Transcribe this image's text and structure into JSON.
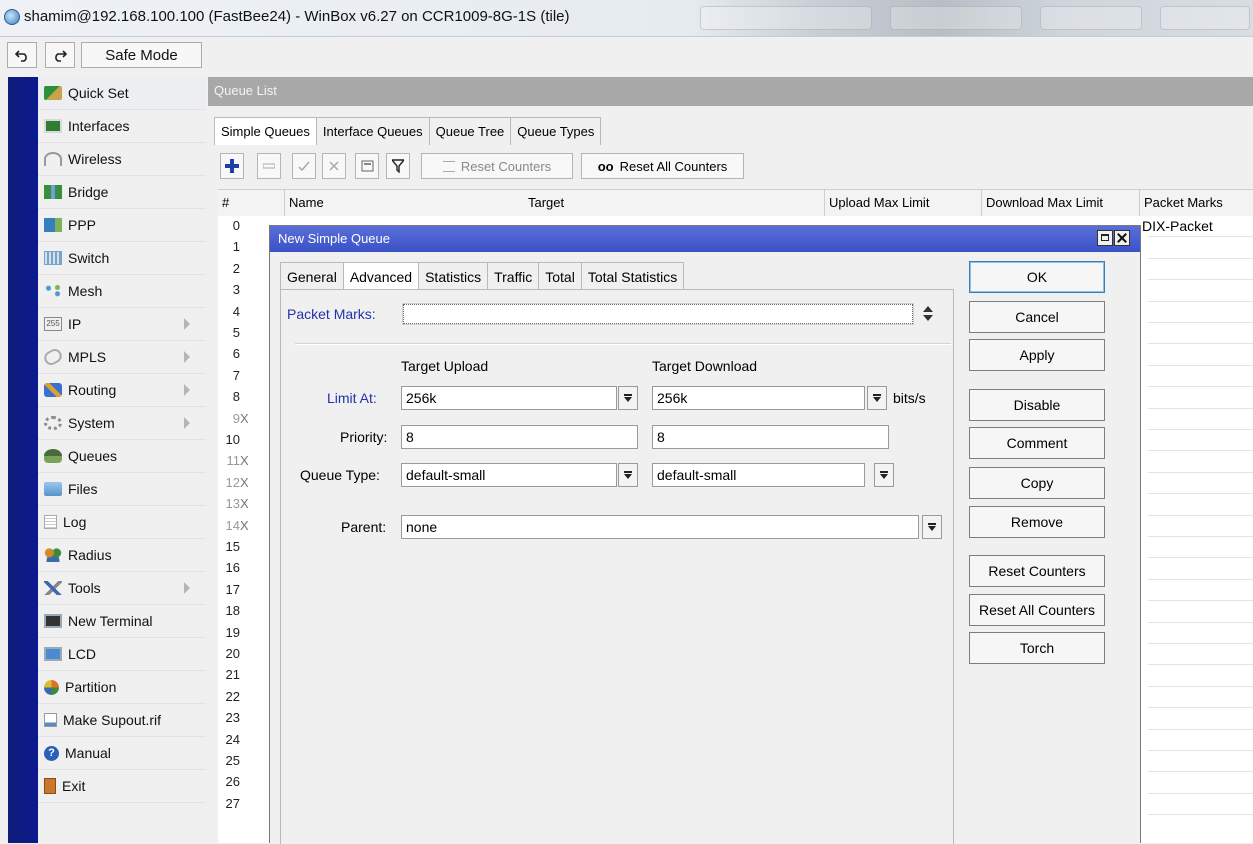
{
  "window": {
    "title": "shamim@192.168.100.100 (FastBee24) - WinBox v6.27 on CCR1009-8G-1S (tile)"
  },
  "toolbar": {
    "undo_icon": "undo-icon",
    "redo_icon": "redo-icon",
    "safe_mode_label": "Safe Mode"
  },
  "menu": {
    "items": [
      {
        "label": "Quick Set",
        "icon": "quick-set-icon",
        "color": "#3a8f3a",
        "submenu": false
      },
      {
        "label": "Interfaces",
        "icon": "interfaces-icon",
        "color": "#2e7d32",
        "submenu": false
      },
      {
        "label": "Wireless",
        "icon": "wireless-icon",
        "color": "#999999",
        "submenu": false
      },
      {
        "label": "Bridge",
        "icon": "bridge-icon",
        "color": "#3c8d3c",
        "submenu": false
      },
      {
        "label": "PPP",
        "icon": "ppp-icon",
        "color": "#3a7cc0",
        "submenu": false
      },
      {
        "label": "Switch",
        "icon": "switch-icon",
        "color": "#7aa3c7",
        "submenu": false
      },
      {
        "label": "Mesh",
        "icon": "mesh-icon",
        "color": "#4a9ad0",
        "submenu": false
      },
      {
        "label": "IP",
        "icon": "ip-icon",
        "color": "#8a8a8a",
        "submenu": true
      },
      {
        "label": "MPLS",
        "icon": "mpls-icon",
        "color": "#9a9a9a",
        "submenu": true
      },
      {
        "label": "Routing",
        "icon": "routing-icon",
        "color": "#3b6fd0",
        "submenu": true
      },
      {
        "label": "System",
        "icon": "system-icon",
        "color": "#8c8c8c",
        "submenu": true
      },
      {
        "label": "Queues",
        "icon": "queues-icon",
        "color": "#5a8a3a",
        "submenu": false
      },
      {
        "label": "Files",
        "icon": "files-icon",
        "color": "#6aa2d8",
        "submenu": false
      },
      {
        "label": "Log",
        "icon": "log-icon",
        "color": "#c0c0c0",
        "submenu": false
      },
      {
        "label": "Radius",
        "icon": "radius-icon",
        "color": "#d08a2a",
        "submenu": false
      },
      {
        "label": "Tools",
        "icon": "tools-icon",
        "color": "#3a6ab0",
        "submenu": true
      },
      {
        "label": "New Terminal",
        "icon": "terminal-icon",
        "color": "#333333",
        "submenu": false
      },
      {
        "label": "LCD",
        "icon": "lcd-icon",
        "color": "#4a8ad0",
        "submenu": false
      },
      {
        "label": "Partition",
        "icon": "partition-icon",
        "color": "#e0702a",
        "submenu": false
      },
      {
        "label": "Make Supout.rif",
        "icon": "supout-icon",
        "color": "#5a8ac0",
        "submenu": false
      },
      {
        "label": "Manual",
        "icon": "manual-icon",
        "color": "#2a60b8",
        "submenu": false
      },
      {
        "label": "Exit",
        "icon": "exit-icon",
        "color": "#c87a2a",
        "submenu": false
      }
    ]
  },
  "queue_list": {
    "header": "Queue List",
    "tabs": [
      "Simple Queues",
      "Interface Queues",
      "Queue Tree",
      "Queue Types"
    ],
    "active_tab": "Simple Queues",
    "toolbar": {
      "add_icon": "plus-icon",
      "remove_icon": "minus-icon",
      "enable_icon": "check-icon",
      "disable_icon": "cross-icon",
      "comment_icon": "comment-icon",
      "filter_icon": "filter-icon",
      "reset_counters": "Reset Counters",
      "reset_all_counters": "Reset All Counters",
      "reset_all_prefix": "oo"
    },
    "columns": [
      "#",
      "Name",
      "Target",
      "Upload Max Limit",
      "Download Max Limit",
      "Packet Marks"
    ],
    "rows": [
      {
        "num": "0",
        "x": "",
        "packet_marks": "DIX-Packet"
      },
      {
        "num": "1",
        "x": ""
      },
      {
        "num": "2",
        "x": ""
      },
      {
        "num": "3",
        "x": ""
      },
      {
        "num": "4",
        "x": ""
      },
      {
        "num": "5",
        "x": ""
      },
      {
        "num": "6",
        "x": ""
      },
      {
        "num": "7",
        "x": ""
      },
      {
        "num": "8",
        "x": ""
      },
      {
        "num": "9",
        "x": "X"
      },
      {
        "num": "10",
        "x": ""
      },
      {
        "num": "11",
        "x": "X"
      },
      {
        "num": "12",
        "x": "X"
      },
      {
        "num": "13",
        "x": "X"
      },
      {
        "num": "14",
        "x": "X"
      },
      {
        "num": "15",
        "x": ""
      },
      {
        "num": "16",
        "x": ""
      },
      {
        "num": "17",
        "x": ""
      },
      {
        "num": "18",
        "x": ""
      },
      {
        "num": "19",
        "x": ""
      },
      {
        "num": "20",
        "x": ""
      },
      {
        "num": "21",
        "x": ""
      },
      {
        "num": "22",
        "x": ""
      },
      {
        "num": "23",
        "x": ""
      },
      {
        "num": "24",
        "x": ""
      },
      {
        "num": "25",
        "x": ""
      },
      {
        "num": "26",
        "x": ""
      },
      {
        "num": "27",
        "x": ""
      }
    ]
  },
  "dialog": {
    "title": "New Simple Queue",
    "tabs": [
      "General",
      "Advanced",
      "Statistics",
      "Traffic",
      "Total",
      "Total Statistics"
    ],
    "active_tab": "Advanced",
    "fields": {
      "packet_marks_label": "Packet Marks:",
      "packet_marks_value": "",
      "target_upload_title": "Target Upload",
      "target_download_title": "Target Download",
      "limit_at_label": "Limit At:",
      "limit_at_upload": "256k",
      "limit_at_download": "256k",
      "limit_unit": "bits/s",
      "priority_label": "Priority:",
      "priority_upload": "8",
      "priority_download": "8",
      "queue_type_label": "Queue Type:",
      "queue_type_upload": "default-small",
      "queue_type_download": "default-small",
      "parent_label": "Parent:",
      "parent_value": "none"
    },
    "buttons": [
      "OK",
      "Cancel",
      "Apply",
      "Disable",
      "Comment",
      "Copy",
      "Remove",
      "Reset Counters",
      "Reset All Counters",
      "Torch"
    ]
  }
}
